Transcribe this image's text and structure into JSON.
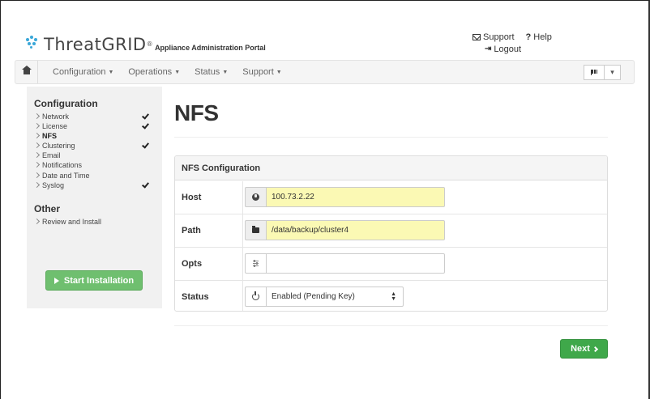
{
  "brand": {
    "logo_text": "ThreatGRID",
    "logo_reg": "®",
    "subtitle": "Appliance Administration Portal"
  },
  "toplinks": {
    "support": "Support",
    "help": "Help",
    "logout": "Logout"
  },
  "navbar": {
    "items": [
      "Configuration",
      "Operations",
      "Status",
      "Support"
    ]
  },
  "sidebar": {
    "configuration_heading": "Configuration",
    "items": [
      {
        "label": "Network",
        "checked": true,
        "active": false
      },
      {
        "label": "License",
        "checked": true,
        "active": false
      },
      {
        "label": "NFS",
        "checked": false,
        "active": true
      },
      {
        "label": "Clustering",
        "checked": true,
        "active": false
      },
      {
        "label": "Email",
        "checked": false,
        "active": false
      },
      {
        "label": "Notifications",
        "checked": false,
        "active": false
      },
      {
        "label": "Date and Time",
        "checked": false,
        "active": false
      },
      {
        "label": "Syslog",
        "checked": true,
        "active": false
      }
    ],
    "other_heading": "Other",
    "other_items": [
      {
        "label": "Review and Install"
      }
    ],
    "start_button": "Start Installation"
  },
  "main": {
    "title": "NFS",
    "panel": {
      "heading": "NFS Configuration",
      "host_label": "Host",
      "host_value": "100.73.2.22",
      "path_label": "Path",
      "path_value": "/data/backup/cluster4",
      "opts_label": "Opts",
      "opts_value": "",
      "status_label": "Status",
      "status_value": "Enabled (Pending Key)"
    },
    "next_button": "Next"
  },
  "colors": {
    "highlight_input": "#fbf9b4",
    "start_button": "#6fbf6f",
    "next_button": "#3fa84a",
    "sidebar_bg": "#f1f1f1"
  }
}
